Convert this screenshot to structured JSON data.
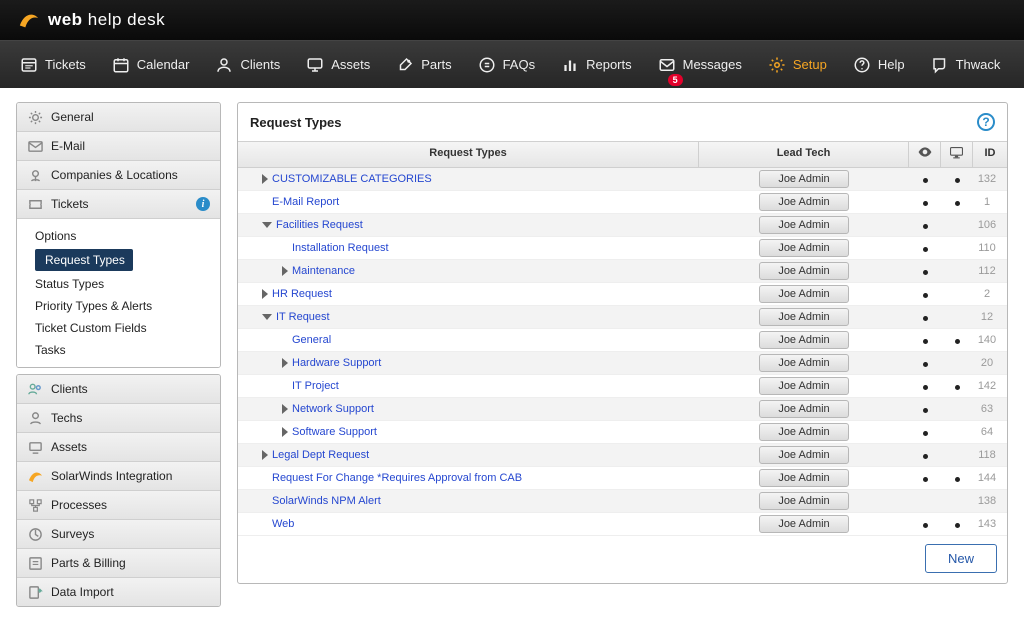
{
  "brand": {
    "name1": "web",
    "name2": "help",
    "name3": "desk"
  },
  "nav": {
    "items": [
      {
        "key": "tickets",
        "label": "Tickets"
      },
      {
        "key": "calendar",
        "label": "Calendar"
      },
      {
        "key": "clients",
        "label": "Clients"
      },
      {
        "key": "assets",
        "label": "Assets"
      },
      {
        "key": "parts",
        "label": "Parts"
      },
      {
        "key": "faqs",
        "label": "FAQs"
      },
      {
        "key": "reports",
        "label": "Reports"
      },
      {
        "key": "messages",
        "label": "Messages",
        "badge": "5"
      },
      {
        "key": "setup",
        "label": "Setup",
        "active": true
      },
      {
        "key": "help",
        "label": "Help"
      },
      {
        "key": "thwack",
        "label": "Thwack"
      }
    ]
  },
  "sidebar": {
    "top": [
      {
        "key": "general",
        "label": "General"
      },
      {
        "key": "email",
        "label": "E-Mail"
      },
      {
        "key": "companies",
        "label": "Companies & Locations"
      },
      {
        "key": "tickets",
        "label": "Tickets",
        "info": true
      }
    ],
    "ticket_sub": [
      {
        "label": "Options"
      },
      {
        "label": "Request Types",
        "selected": true
      },
      {
        "label": "Status Types"
      },
      {
        "label": "Priority Types & Alerts"
      },
      {
        "label": "Ticket Custom Fields"
      },
      {
        "label": "Tasks"
      }
    ],
    "bottom": [
      {
        "key": "clients",
        "label": "Clients"
      },
      {
        "key": "techs",
        "label": "Techs"
      },
      {
        "key": "assets",
        "label": "Assets"
      },
      {
        "key": "integration",
        "label": "SolarWinds Integration"
      },
      {
        "key": "processes",
        "label": "Processes"
      },
      {
        "key": "surveys",
        "label": "Surveys"
      },
      {
        "key": "billing",
        "label": "Parts & Billing"
      },
      {
        "key": "dataimport",
        "label": "Data Import"
      }
    ]
  },
  "panel": {
    "title": "Request Types",
    "columns": {
      "name": "Request Types",
      "tech": "Lead Tech",
      "id": "ID"
    },
    "new_label": "New",
    "rows": [
      {
        "arrow": "right",
        "indent": 0,
        "name": "CUSTOMIZABLE CATEGORIES",
        "tech": "Joe Admin",
        "eye": true,
        "disp": true,
        "id": "132"
      },
      {
        "arrow": "",
        "indent": 0,
        "name": "E-Mail Report",
        "tech": "Joe Admin",
        "eye": true,
        "disp": true,
        "id": "1"
      },
      {
        "arrow": "down",
        "indent": 0,
        "name": "Facilities Request",
        "tech": "Joe Admin",
        "eye": true,
        "disp": false,
        "id": "106"
      },
      {
        "arrow": "",
        "indent": 1,
        "name": "Installation Request",
        "tech": "Joe Admin",
        "eye": true,
        "disp": false,
        "id": "110"
      },
      {
        "arrow": "right",
        "indent": 1,
        "name": "Maintenance",
        "tech": "Joe Admin",
        "eye": true,
        "disp": false,
        "id": "112"
      },
      {
        "arrow": "right",
        "indent": 0,
        "name": "HR Request",
        "tech": "Joe Admin",
        "eye": true,
        "disp": false,
        "id": "2"
      },
      {
        "arrow": "down",
        "indent": 0,
        "name": "IT Request",
        "tech": "Joe Admin",
        "eye": true,
        "disp": false,
        "id": "12"
      },
      {
        "arrow": "",
        "indent": 1,
        "name": "General",
        "tech": "Joe Admin",
        "eye": true,
        "disp": true,
        "id": "140"
      },
      {
        "arrow": "right",
        "indent": 1,
        "name": "Hardware Support",
        "tech": "Joe Admin",
        "eye": true,
        "disp": false,
        "id": "20"
      },
      {
        "arrow": "",
        "indent": 1,
        "name": "IT Project",
        "tech": "Joe Admin",
        "eye": true,
        "disp": true,
        "id": "142"
      },
      {
        "arrow": "right",
        "indent": 1,
        "name": "Network Support",
        "tech": "Joe Admin",
        "eye": true,
        "disp": false,
        "id": "63"
      },
      {
        "arrow": "right",
        "indent": 1,
        "name": "Software Support",
        "tech": "Joe Admin",
        "eye": true,
        "disp": false,
        "id": "64"
      },
      {
        "arrow": "right",
        "indent": 0,
        "name": "Legal Dept Request",
        "tech": "Joe Admin",
        "eye": true,
        "disp": false,
        "id": "118"
      },
      {
        "arrow": "",
        "indent": 0,
        "name": "Request For Change *Requires Approval from CAB",
        "tech": "Joe Admin",
        "eye": true,
        "disp": true,
        "id": "144"
      },
      {
        "arrow": "",
        "indent": 0,
        "name": "SolarWinds NPM Alert",
        "tech": "Joe Admin",
        "eye": false,
        "disp": false,
        "id": "138"
      },
      {
        "arrow": "",
        "indent": 0,
        "name": "Web",
        "tech": "Joe Admin",
        "eye": true,
        "disp": true,
        "id": "143"
      }
    ]
  }
}
